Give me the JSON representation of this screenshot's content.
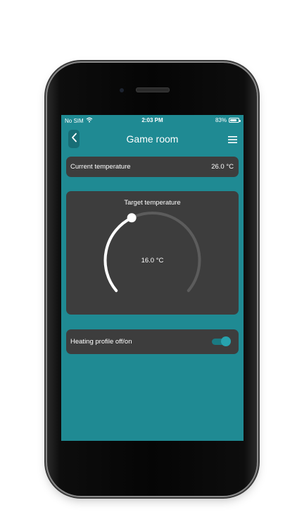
{
  "status_bar": {
    "carrier": "No SIM",
    "time": "2:03 PM",
    "battery": "83%",
    "battery_level": 0.83
  },
  "header": {
    "title": "Game room",
    "back_icon": "chevron-left-icon",
    "menu_icon": "hamburger-menu-icon"
  },
  "current_temperature": {
    "label": "Current temperature",
    "value": "26.0 °C"
  },
  "target_temperature": {
    "label": "Target temperature",
    "value": "16.0 °C",
    "dial_fraction": 0.4
  },
  "heating_profile": {
    "label": "Heating profile off/on",
    "enabled": true
  },
  "colors": {
    "background": "#1f8a93",
    "card": "#3d3d3d",
    "accent": "#27a3ae"
  }
}
